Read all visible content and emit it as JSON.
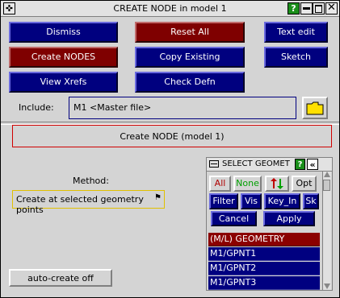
{
  "window": {
    "title": "CREATE NODE in model 1",
    "help_label": "?"
  },
  "buttons": {
    "dismiss": "Dismiss",
    "reset_all": "Reset All",
    "text_edit": "Text edit",
    "create_nodes": "Create NODES",
    "copy_existing": "Copy Existing",
    "sketch": "Sketch",
    "view_xrefs": "View Xrefs",
    "check_defn": "Check Defn"
  },
  "include": {
    "label": "Include:",
    "value": "M1  <Master file>"
  },
  "main_panel": {
    "title": "Create NODE (model 1)"
  },
  "method": {
    "label": "Method:",
    "value": "Create at selected geometry points"
  },
  "auto_create": {
    "label": "auto-create off"
  },
  "select_panel": {
    "title": "SELECT GEOMET",
    "help_label": "?",
    "all_label": "All",
    "none_label": "None",
    "opt_label": "Opt",
    "filter_label": "Filter",
    "vis_label": "Vis",
    "key_in_label": "Key_In",
    "sk_label": "Sk",
    "cancel_label": "Cancel",
    "apply_label": "Apply",
    "list_header": "(M/L) GEOMETRY POINT(s)",
    "items": [
      "M1/GPNT1",
      "M1/GPNT2",
      "M1/GPNT3"
    ]
  },
  "colors": {
    "button_blue": "#00007f",
    "button_red": "#7f0000",
    "help_green": "#1a8f1a",
    "folder_yellow": "#ffe000",
    "none_green": "#00a000",
    "all_red": "#b00000"
  }
}
